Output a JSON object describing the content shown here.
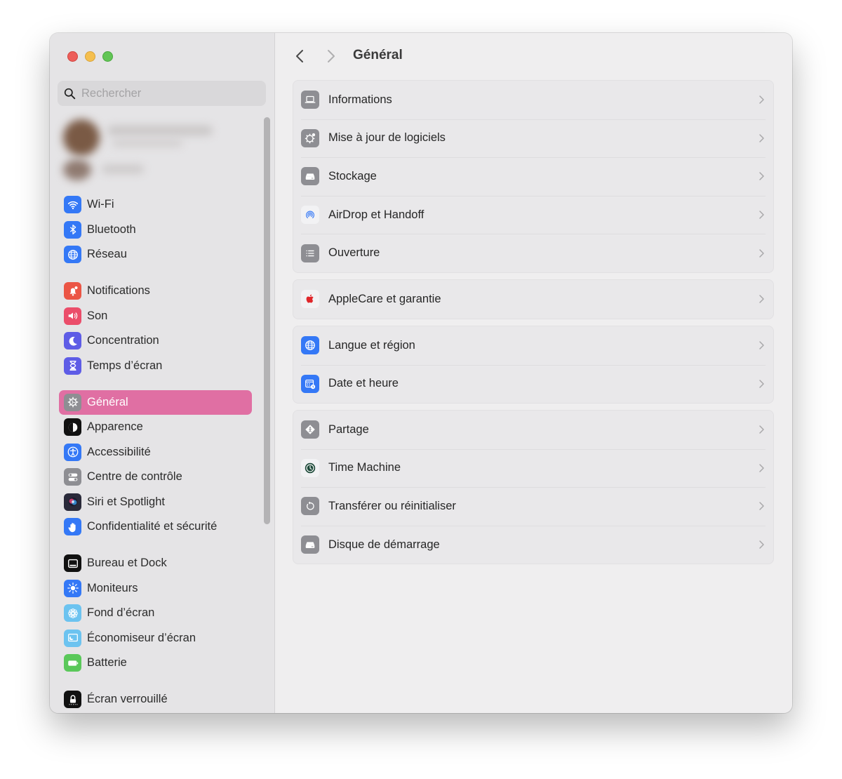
{
  "window": {
    "controls": {
      "close": "close",
      "minimize": "minimize",
      "zoom": "zoom"
    }
  },
  "sidebar": {
    "search": {
      "placeholder": "Rechercher",
      "value": ""
    },
    "groups": [
      [
        {
          "label": "Wi-Fi",
          "icon": "wifi-icon",
          "color": "#3478f6"
        },
        {
          "label": "Bluetooth",
          "icon": "bluetooth-icon",
          "color": "#3478f6"
        },
        {
          "label": "Réseau",
          "icon": "globe-icon",
          "color": "#3478f6"
        }
      ],
      [
        {
          "label": "Notifications",
          "icon": "bell-icon",
          "color": "#eb5545"
        },
        {
          "label": "Son",
          "icon": "speaker-icon",
          "color": "#eb4d6a"
        },
        {
          "label": "Concentration",
          "icon": "moon-icon",
          "color": "#5e5ce6"
        },
        {
          "label": "Temps d’écran",
          "icon": "hourglass-icon",
          "color": "#5e5ce6"
        }
      ],
      [
        {
          "label": "Général",
          "icon": "gear-icon",
          "color": "#8e8e93",
          "active": true
        },
        {
          "label": "Apparence",
          "icon": "appearance-icon",
          "color": "#111111"
        },
        {
          "label": "Accessibilité",
          "icon": "accessibility-icon",
          "color": "#3478f6"
        },
        {
          "label": "Centre de contrôle",
          "icon": "toggles-icon",
          "color": "#8e8e93"
        },
        {
          "label": "Siri et Spotlight",
          "icon": "siri-icon",
          "color": "#2a2a3a"
        },
        {
          "label": "Confidentialité et sécurité",
          "icon": "hand-icon",
          "color": "#3478f6"
        }
      ],
      [
        {
          "label": "Bureau et Dock",
          "icon": "dock-icon",
          "color": "#111111"
        },
        {
          "label": "Moniteurs",
          "icon": "brightness-icon",
          "color": "#3478f6"
        },
        {
          "label": "Fond d’écran",
          "icon": "flower-icon",
          "color": "#6cc3f0"
        },
        {
          "label": "Économiseur d’écran",
          "icon": "screensaver-icon",
          "color": "#6cc3f0"
        },
        {
          "label": "Batterie",
          "icon": "battery-icon",
          "color": "#5ac85a"
        }
      ],
      [
        {
          "label": "Écran verrouillé",
          "icon": "lock-icon",
          "color": "#111111"
        }
      ]
    ]
  },
  "main": {
    "title": "Général",
    "back_label": "Précédent",
    "forward_label": "Suivant",
    "groups": [
      [
        {
          "label": "Informations",
          "icon": "laptop-icon",
          "color": "#8e8e93"
        },
        {
          "label": "Mise à jour de logiciels",
          "icon": "gear-badge-icon",
          "color": "#8e8e93"
        },
        {
          "label": "Stockage",
          "icon": "drive-icon",
          "color": "#8e8e93"
        },
        {
          "label": "AirDrop et Handoff",
          "icon": "airdrop-icon",
          "color": "#f2f2f4"
        },
        {
          "label": "Ouverture",
          "icon": "list-icon",
          "color": "#8e8e93"
        }
      ],
      [
        {
          "label": "AppleCare et garantie",
          "icon": "apple-icon",
          "color": "#f2f2f4"
        }
      ],
      [
        {
          "label": "Langue et région",
          "icon": "globe-icon",
          "color": "#3478f6"
        },
        {
          "label": "Date et heure",
          "icon": "calendar-clock-icon",
          "color": "#3478f6"
        }
      ],
      [
        {
          "label": "Partage",
          "icon": "sharing-icon",
          "color": "#8e8e93"
        },
        {
          "label": "Time Machine",
          "icon": "time-machine-icon",
          "color": "#f2f2f4"
        },
        {
          "label": "Transférer ou réinitialiser",
          "icon": "reset-icon",
          "color": "#8e8e93"
        },
        {
          "label": "Disque de démarrage",
          "icon": "drive-icon",
          "color": "#8e8e93"
        }
      ]
    ]
  }
}
